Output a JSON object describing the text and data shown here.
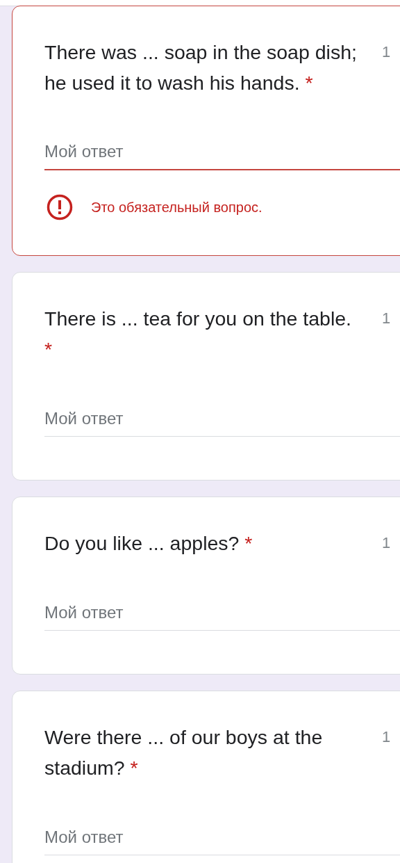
{
  "questions": [
    {
      "text": "There was ... soap in the soap dish; he used it to wash his hands.",
      "required_mark": "*",
      "points": "1",
      "answer": {
        "placeholder": "Мой ответ"
      },
      "error": "Это обязательный вопрос."
    },
    {
      "text": "There is ... tea for you on the table.",
      "required_mark": "*",
      "points": "1",
      "answer": {
        "placeholder": "Мой ответ"
      }
    },
    {
      "text": "Do you like ... apples?",
      "required_mark": "*",
      "points": "1",
      "answer": {
        "placeholder": "Мой ответ"
      }
    },
    {
      "text": "Were there ... of our boys at the stadium?",
      "required_mark": "*",
      "points": "1",
      "answer": {
        "placeholder": "Мой ответ"
      }
    }
  ]
}
